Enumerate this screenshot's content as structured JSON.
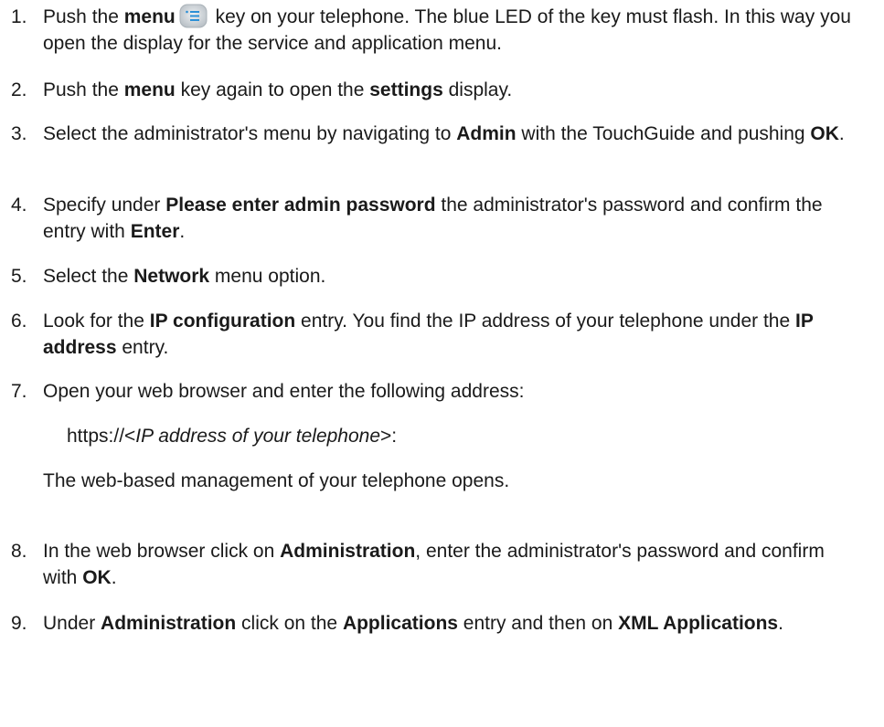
{
  "steps": [
    {
      "num": "1.",
      "parts": [
        {
          "t": "Push the "
        },
        {
          "t": "menu",
          "b": true
        },
        {
          "icon": "menu-key-icon"
        },
        {
          "t": " key on your telephone. The blue LED of the key must flash. In this way you open the display for the service and application menu."
        }
      ]
    },
    {
      "num": "2.",
      "parts": [
        {
          "t": "Push the "
        },
        {
          "t": "menu",
          "b": true
        },
        {
          "t": " key again to open the "
        },
        {
          "t": "settings",
          "b": true
        },
        {
          "t": " display."
        }
      ]
    },
    {
      "num": "3.",
      "parts": [
        {
          "t": "Select the administrator's menu by navigating to "
        },
        {
          "t": "Admin",
          "b": true
        },
        {
          "t": " with the TouchGuide and pushing "
        },
        {
          "t": "OK",
          "b": true
        },
        {
          "t": "."
        }
      ]
    },
    {
      "num": "4.",
      "parts": [
        {
          "t": "Specify under "
        },
        {
          "t": "Please enter admin password",
          "b": true
        },
        {
          "t": " the administrator's password and confirm the entry with "
        },
        {
          "t": "Enter",
          "b": true
        },
        {
          "t": "."
        }
      ]
    },
    {
      "num": "5.",
      "parts": [
        {
          "t": "Select the "
        },
        {
          "t": "Network",
          "b": true
        },
        {
          "t": " menu option."
        }
      ]
    },
    {
      "num": "6.",
      "parts": [
        {
          "t": "Look for the "
        },
        {
          "t": "IP configuration",
          "b": true
        },
        {
          "t": " entry. You find the IP address of your telephone under the "
        },
        {
          "t": "IP address",
          "b": true
        },
        {
          "t": " entry."
        }
      ]
    },
    {
      "num": "7.",
      "parts": [
        {
          "t": "Open your web browser and enter the following address:"
        }
      ]
    },
    {
      "num": "8.",
      "parts": [
        {
          "t": "In the web browser click on "
        },
        {
          "t": "Administration",
          "b": true
        },
        {
          "t": ", enter the administrator's password and confirm with "
        },
        {
          "t": "OK",
          "b": true
        },
        {
          "t": "."
        }
      ]
    },
    {
      "num": "9.",
      "parts": [
        {
          "t": "Under "
        },
        {
          "t": "Administration",
          "b": true
        },
        {
          "t": " click on the "
        },
        {
          "t": "Applications",
          "b": true
        },
        {
          "t": " entry and then on "
        },
        {
          "t": "XML Applications",
          "b": true
        },
        {
          "t": "."
        }
      ]
    }
  ],
  "address_line": {
    "prefix": "https://<",
    "italic": "IP address of your telephone",
    "suffix": ">:"
  },
  "result_line": "The web-based management of your telephone opens.",
  "icon_colors": {
    "menu_key_bg": "#d4d9dd",
    "menu_key_glyph": "#2b8fd6"
  }
}
